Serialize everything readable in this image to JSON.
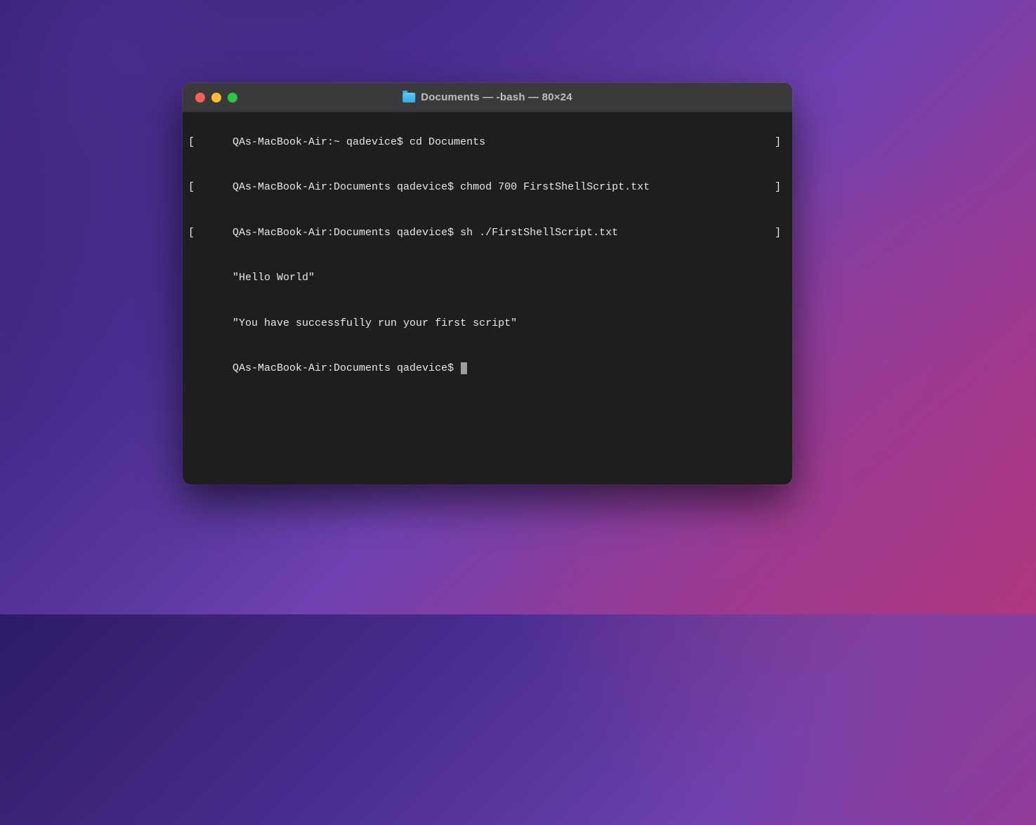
{
  "window": {
    "title": "Documents — -bash — 80×24"
  },
  "terminal": {
    "lines": [
      {
        "bracketed": true,
        "text": "QAs-MacBook-Air:~ qadevice$ cd Documents"
      },
      {
        "bracketed": true,
        "text": "QAs-MacBook-Air:Documents qadevice$ chmod 700 FirstShellScript.txt"
      },
      {
        "bracketed": true,
        "text": "QAs-MacBook-Air:Documents qadevice$ sh ./FirstShellScript.txt"
      },
      {
        "bracketed": false,
        "text": "\"Hello World\""
      },
      {
        "bracketed": false,
        "text": "\"You have successfully run your first script\""
      }
    ],
    "prompt": "QAs-MacBook-Air:Documents qadevice$ "
  }
}
